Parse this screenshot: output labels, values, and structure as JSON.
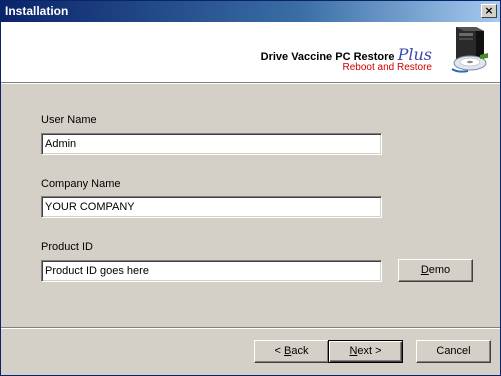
{
  "window": {
    "title": "Installation"
  },
  "banner": {
    "product_name": "Drive Vaccine PC Restore",
    "product_suffix": "Plus",
    "tagline": "Reboot and Restore"
  },
  "form": {
    "user_name": {
      "label": "User Name",
      "value": "Admin"
    },
    "company_name": {
      "label": "Company Name",
      "value": "YOUR COMPANY"
    },
    "product_id": {
      "label": "Product ID",
      "value": "Product ID goes here"
    }
  },
  "buttons": {
    "demo": {
      "mnemonic": "D",
      "rest": "emo"
    },
    "back": {
      "prefix": "< ",
      "mnemonic": "B",
      "rest": "ack"
    },
    "next": {
      "mnemonic": "N",
      "rest": "ext >"
    },
    "cancel": "Cancel"
  },
  "icons": {
    "close": "close-icon",
    "logo": "pc-restore-logo"
  }
}
